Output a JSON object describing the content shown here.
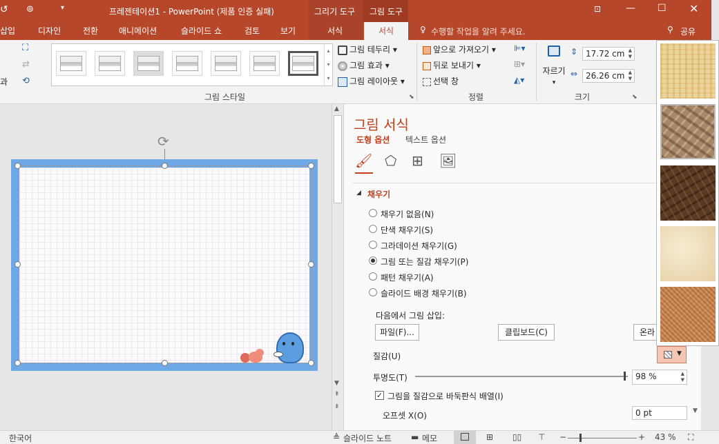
{
  "titlebar": {
    "title": "프레젠테이션1 - PowerPoint (제품 인증 실패)",
    "ctx_drawing": "그리기 도구",
    "ctx_picture": "그림 도구",
    "colors": {
      "accent": "#b7472a",
      "accent_dark": "#9e3b22",
      "link": "#c43e1c"
    }
  },
  "tabs": [
    "삽입",
    "디자인",
    "전환",
    "애니메이션",
    "슬라이드 쇼",
    "검토",
    "보기",
    "서식",
    "서식"
  ],
  "tell_me": "수행할 작업을 알려 주세요.",
  "share": "공유",
  "ribbon": {
    "left_cut": "과",
    "border": "그림 테두리",
    "effects": "그림 효과",
    "layout": "그림 레이아웃",
    "style_group": "그림 스타일",
    "bring_forward": "앞으로 가져오기",
    "send_backward": "뒤로 보내기",
    "selection_pane": "선택 창",
    "arrange_group": "정렬",
    "crop": "자르기",
    "height": "17.72 cm",
    "width": "26.26 cm",
    "size_group": "크기"
  },
  "pane": {
    "title": "그림 서식",
    "tab_shape": "도형 옵션",
    "tab_text": "텍스트 옵션",
    "section_fill": "채우기",
    "fill_options": [
      {
        "label": "채우기 없음(N)",
        "selected": false
      },
      {
        "label": "단색 채우기(S)",
        "selected": false
      },
      {
        "label": "그라데이션 채우기(G)",
        "selected": false
      },
      {
        "label": "그림 또는 질감 채우기(P)",
        "selected": true
      },
      {
        "label": "패턴 채우기(A)",
        "selected": false
      },
      {
        "label": "슬라이드 배경 채우기(B)",
        "selected": false
      }
    ],
    "insert_from": "다음에서 그림 삽입:",
    "file_button": "파일(F)...",
    "clipboard_button": "클립보드(C)",
    "online_button": "온라",
    "texture_label": "질감(U)",
    "transparency_label": "투명도(T)",
    "transparency_value": "98 %",
    "transparency_fraction": 0.98,
    "tile_label": "그림을 질감으로 바둑판식 배열(I)",
    "tile_checked": true,
    "offset_label": "오프셋 X(O)",
    "offset_value": "0 pt"
  },
  "statusbar": {
    "language": "한국어",
    "notes": "슬라이드 노트",
    "comments": "메모",
    "zoom": "43 %"
  }
}
